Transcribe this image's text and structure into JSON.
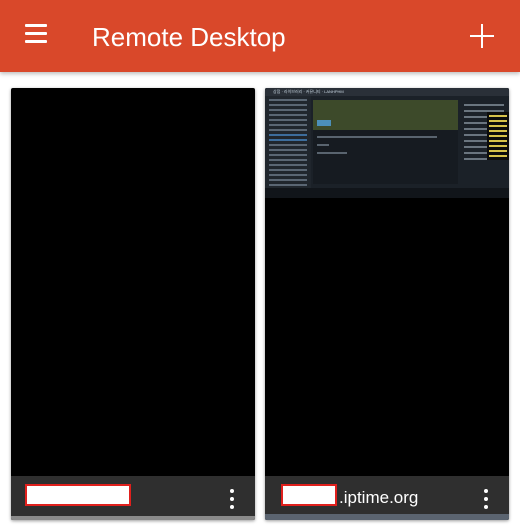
{
  "appbar": {
    "title": "Remote Desktop",
    "menu_icon": "hamburger-menu-icon",
    "add_icon": "plus-icon",
    "color": "#d9482a"
  },
  "connections": [
    {
      "name": ""
    },
    {
      "name": ".iptime.org",
      "thumbnail_nav": "상점 · 라이브러리 · 커뮤니티 · LANHPHM"
    }
  ]
}
